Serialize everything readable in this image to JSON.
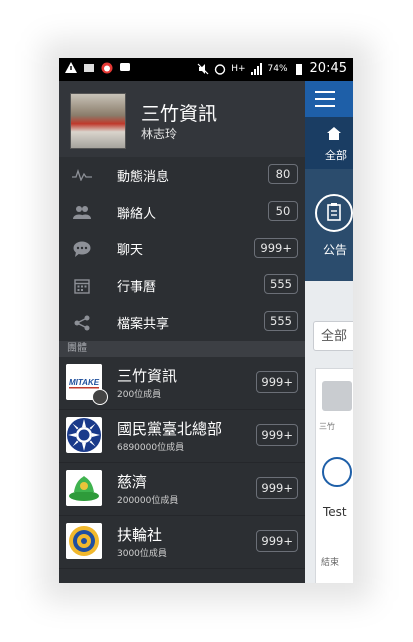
{
  "status_bar": {
    "time": "20:45",
    "battery": "74%",
    "network": "H+",
    "icons": [
      "warning-icon",
      "sim-icon",
      "alarm-app-icon",
      "chat-icon",
      "mute-icon",
      "alarm-icon",
      "signal-icon",
      "battery-icon"
    ]
  },
  "profile": {
    "title": "三竹資訊",
    "subtitle": "林志玲"
  },
  "menu": [
    {
      "label": "動態消息",
      "count": "80",
      "icon": "activity-icon"
    },
    {
      "label": "聯絡人",
      "count": "50",
      "icon": "contacts-icon"
    },
    {
      "label": "聊天",
      "count": "999+",
      "icon": "chat-icon"
    },
    {
      "label": "行事曆",
      "count": "555",
      "icon": "calendar-icon"
    },
    {
      "label": "檔案共享",
      "count": "555",
      "icon": "share-icon"
    }
  ],
  "section": {
    "header": "團體"
  },
  "groups": [
    {
      "name": "三竹資訊",
      "members": "200位成員",
      "count": "999+",
      "logo_text": "MITAKE"
    },
    {
      "name": "國民黨臺北總部",
      "members": "6890000位成員",
      "count": "999+"
    },
    {
      "name": "慈濟",
      "members": "200000位成員",
      "count": "999+"
    },
    {
      "name": "扶輪社",
      "members": "3000位成員",
      "count": "999+"
    }
  ],
  "main_panel": {
    "tab_label": "全部",
    "notice_label": "公告",
    "filter_label": "全部",
    "card_tag": "三竹",
    "card_text": "Test",
    "card_footer": "結束"
  },
  "colors": {
    "drawer_bg": "#2c2f33",
    "topbar": "#1e5fa8",
    "banner": "#2b4c6d"
  }
}
